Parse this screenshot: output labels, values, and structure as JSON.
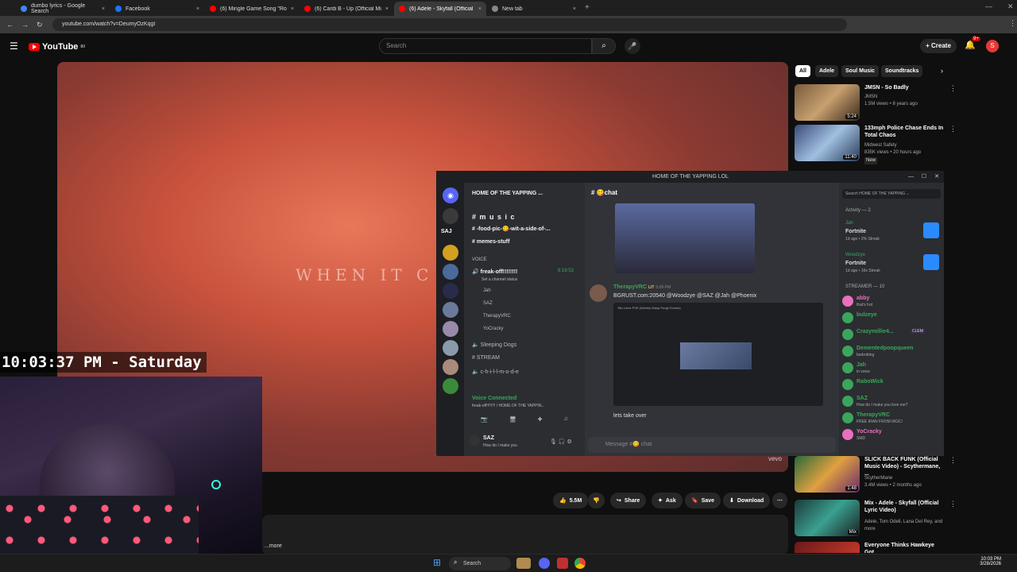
{
  "browser": {
    "tabs": [
      {
        "title": "dumbo lyrics - Google Search",
        "color": "#4285f4"
      },
      {
        "title": "Facebook",
        "color": "#1877f2"
      },
      {
        "title": "(6) Mingle Game Song \"Round",
        "color": "#ff0000"
      },
      {
        "title": "(6) Cardi B - Up (Official Music",
        "color": "#ff0000"
      },
      {
        "title": "(6) Adele - Skyfall (Official Lyric",
        "color": "#ff0000"
      },
      {
        "title": "New tab",
        "color": "#888888"
      }
    ],
    "new_tab_glyph": "+",
    "close_glyph": "×",
    "url": "youtube.com/watch?v=DeumyOzKqgI"
  },
  "youtube": {
    "logo_text": "YouTube",
    "logo_sup": "80",
    "search_placeholder": "Search",
    "create_label": "Create",
    "notif_count": "9+",
    "avatar_letter": "S",
    "lyric_text": "WHEN IT C",
    "vevo": "vevo",
    "actions": {
      "likes": "5.5M",
      "share": "Share",
      "ask": "Ask",
      "save": "Save",
      "download": "Download"
    },
    "more": "...more",
    "chips": [
      "All",
      "Adele",
      "Soul Music",
      "Soundtracks"
    ],
    "recs": [
      {
        "title": "JMSN - So Badly",
        "channel": "JMSN",
        "meta": "1.5M views • 8 years ago",
        "duration": "5:24"
      },
      {
        "title": "133mph Police Chase Ends In Total Chaos",
        "channel": "Midwest Safety",
        "meta": "835K views • 20 hours ago",
        "badge": "New",
        "duration": "11:40"
      },
      {
        "title": "SLICK BACK FUNK (Official Music Video) - Scythermane, ...",
        "channel": "ScytherMane",
        "meta": "3.4M views • 2 months ago",
        "duration": "1:48"
      },
      {
        "title": "Mix - Adele - Skyfall (Official Lyric Video)",
        "channel": "Adele, Tom Odell, Lana Del Rey, and more",
        "meta": "",
        "duration": "Mix"
      },
      {
        "title": "Everyone Thinks Hawkeye Got",
        "channel": "",
        "meta": "",
        "duration": ""
      }
    ]
  },
  "overlay": {
    "clock": "10:03:37 PM - Saturday"
  },
  "discord": {
    "window_title": "HOME OF THE YAPPING LOL",
    "server_name": "HOME OF THE YAPPING ...",
    "server_tag": "SAJ",
    "channels": {
      "music": "# m u s i c",
      "food": "-food-pic-😋-wit-a-side-of-...",
      "memes": "memes-stuff",
      "voice_header": "VOICE",
      "voice_channel": "freak-off!!!!!!!!",
      "voice_status": "Set a channel status",
      "voice_time": "8:18:53",
      "voice_users": [
        "Jah",
        "SAZ",
        "TherapyVRC",
        "YoCracky"
      ],
      "sleeping": "Sleeping Dogs",
      "stream": "# STREAM",
      "chill": "c-h-i-l-l-m-o-d-e"
    },
    "voice_connected": "Voice Connected",
    "voice_connected_sub": "freak-off!!!!!!!! / HOME OF THE YAPPIN...",
    "user": {
      "name": "SAZ",
      "status": "How do I make you"
    },
    "chat_channel": "chat",
    "message": {
      "author": "TherapyVRC",
      "tag": "LIT",
      "time": "5:09 PM",
      "text": "BGRUST.com:20540 @Woodzye @SAZ @Jah @Phoenix",
      "embed_title": "Blu Lines PVE (Weekly Wasp Purge Events)",
      "followup": "lets take over"
    },
    "composer_placeholder": "Message #😋 chat",
    "search_placeholder": "Search HOME OF THE YAPPING ...",
    "activity_header": "Activity — 2",
    "activities": [
      {
        "user": "Jah",
        "game": "Fortnite",
        "meta": "1d ago • 2% Streak"
      },
      {
        "user": "Woodzye",
        "game": "Fortnite",
        "meta": "1d ago • 16x Streak"
      }
    ],
    "streamer_header": "STREAMER — 10",
    "members": [
      {
        "name": "abby",
        "status": "that's hot",
        "color": "#e96fbf"
      },
      {
        "name": "bulzeye",
        "status": "",
        "color": "#3ba55c"
      },
      {
        "name": "Crazymillie4...",
        "status": "",
        "color": "#3ba55c",
        "tag": "CLEM"
      },
      {
        "name": "Dementedpoopqueen",
        "status": "bedrotting",
        "color": "#3ba55c"
      },
      {
        "name": "Jah",
        "status": "in voice",
        "color": "#3ba55c"
      },
      {
        "name": "RaboWick",
        "status": "",
        "color": "#3ba55c"
      },
      {
        "name": "SAZ",
        "status": "How do I make you love me?",
        "color": "#3ba55c"
      },
      {
        "name": "TherapyVRC",
        "status": "FREE IRAN FROM IRGC!",
        "color": "#3ba55c"
      },
      {
        "name": "YoCracky",
        "status": "SMD",
        "color": "#e96fbf"
      }
    ]
  },
  "taskbar": {
    "search": "Search",
    "time": "10:03 PM",
    "date": "3/28/2026"
  }
}
